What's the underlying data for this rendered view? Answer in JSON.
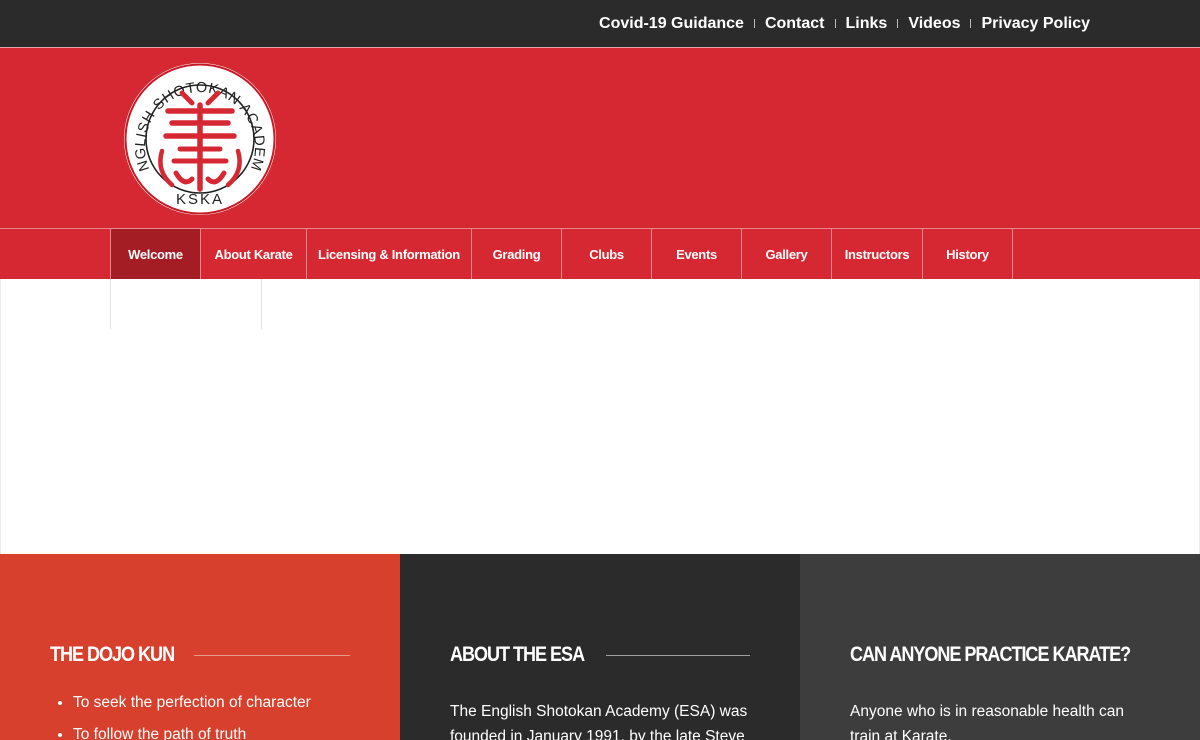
{
  "top_links": [
    "Covid-19 Guidance",
    "Contact",
    "Links",
    "Videos",
    "Privacy Policy"
  ],
  "logo": {
    "ring_text": "ENGLISH SHOTOKAN ACADEMY",
    "bottom_text": "KSKA"
  },
  "nav": {
    "items": [
      "Welcome",
      "About Karate",
      "Licensing & Information",
      "Grading",
      "Clubs",
      "Events",
      "Gallery",
      "Instructors",
      "History"
    ],
    "active": "Welcome"
  },
  "panels": [
    {
      "title": "THE DOJO KUN",
      "list": [
        "To seek the perfection of character",
        "To follow the path of truth"
      ]
    },
    {
      "title": "ABOUT THE ESA",
      "text": "The English Shotokan Academy (ESA) was founded in January 1991, by the late Steve"
    },
    {
      "title": "CAN ANYONE PRACTICE KARATE?",
      "text": "Anyone who is in reasonable health can train at Karate."
    }
  ],
  "colors": {
    "topbar": "#2b2b2b",
    "brand_red": "#d62832",
    "nav_active": "#a51d24",
    "panel_orange": "#d6402d",
    "panel_dark": "#2b2b2b",
    "panel_grey": "#3d3d3d"
  }
}
